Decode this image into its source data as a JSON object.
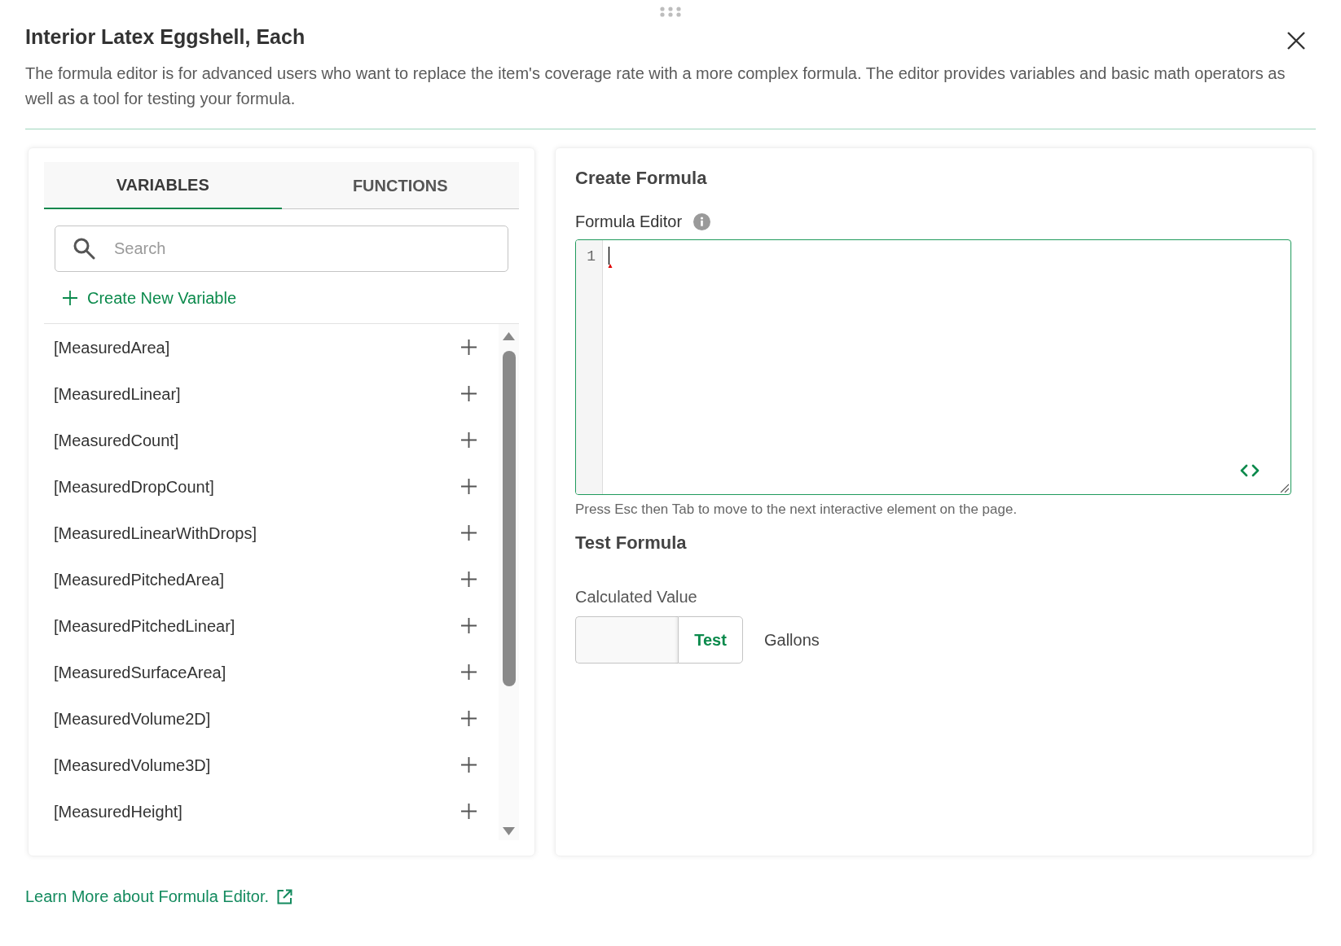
{
  "dialog": {
    "title": "Interior Latex Eggshell, Each",
    "description": "The formula editor is for advanced users who want to replace the item's coverage rate with a more complex formula. The editor provides variables and basic math operators as well as a tool for testing your formula."
  },
  "variables_panel": {
    "tabs": [
      {
        "label": "VARIABLES",
        "selected": true
      },
      {
        "label": "FUNCTIONS",
        "selected": false
      }
    ],
    "search": {
      "placeholder": "Search"
    },
    "create_link": "Create New Variable",
    "items": [
      "[MeasuredArea]",
      "[MeasuredLinear]",
      "[MeasuredCount]",
      "[MeasuredDropCount]",
      "[MeasuredLinearWithDrops]",
      "[MeasuredPitchedArea]",
      "[MeasuredPitchedLinear]",
      "[MeasuredSurfaceArea]",
      "[MeasuredVolume2D]",
      "[MeasuredVolume3D]",
      "[MeasuredHeight]"
    ]
  },
  "formula_panel": {
    "title": "Create Formula",
    "editor_label": "Formula Editor",
    "editor": {
      "line_numbers": [
        "1"
      ]
    },
    "hint": "Press Esc then Tab to move to the next interactive element on the page.",
    "test_title": "Test Formula",
    "calculated_label": "Calculated Value",
    "test_button": "Test",
    "unit": "Gallons"
  },
  "footer_link": "Learn More about Formula Editor."
}
